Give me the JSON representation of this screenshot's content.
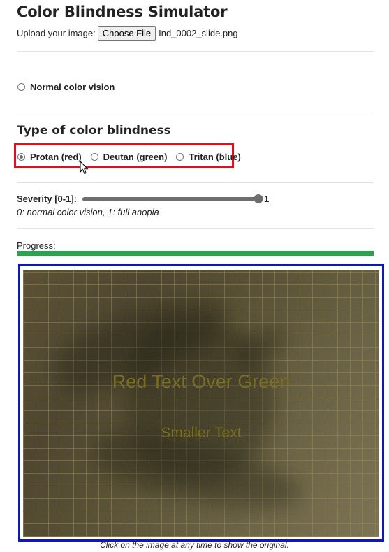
{
  "app": {
    "title": "Color Blindness Simulator"
  },
  "upload": {
    "label": "Upload your image:",
    "button_label": "Choose File",
    "file_name": "Ind_0002_slide.png"
  },
  "normal_option": {
    "label": "Normal color vision",
    "checked": false
  },
  "type_section": {
    "title": "Type of color blindness",
    "highlight_color": "#e0101a",
    "options": [
      {
        "label": "Protan (red)",
        "checked": true
      },
      {
        "label": "Deutan (green)",
        "checked": false
      },
      {
        "label": "Tritan (blue)",
        "checked": false
      }
    ]
  },
  "severity": {
    "label": "Severity [0-1]:",
    "value": 1,
    "value_text": "1",
    "hint": "0: normal color vision, 1: full anopia"
  },
  "progress": {
    "label": "Progress:",
    "fraction": 1.0,
    "color": "#2da152"
  },
  "image": {
    "frame_color": "#0a16c8",
    "text_big": "Red Text Over Green",
    "text_small": "Smaller Text",
    "caption": "Click on the image at any time to show the original."
  }
}
